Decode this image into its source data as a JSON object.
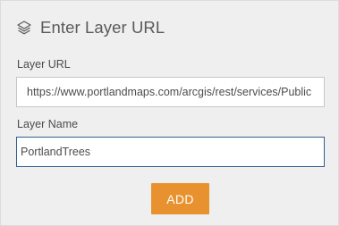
{
  "dialog": {
    "title": "Enter Layer URL",
    "title_icon": "layers-icon"
  },
  "form": {
    "url_label": "Layer URL",
    "url_value": "https://www.portlandmaps.com/arcgis/rest/services/Public",
    "name_label": "Layer Name",
    "name_value": "PortlandTrees"
  },
  "actions": {
    "add_label": "ADD",
    "add_color": "#e8912f"
  }
}
